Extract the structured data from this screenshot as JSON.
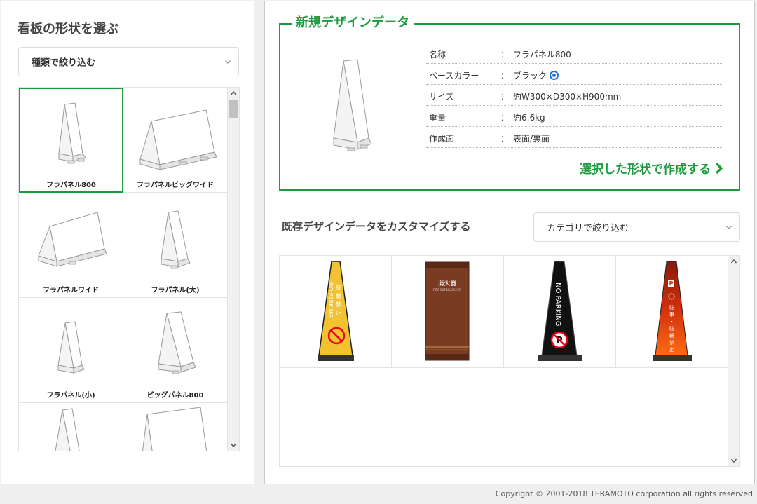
{
  "left_panel": {
    "title": "看板の形状を選ぶ",
    "filter": {
      "selected": "種類で絞り込む"
    },
    "shapes": [
      {
        "label": "フラパネル800",
        "selected": true
      },
      {
        "label": "フラパネルビッグワイド",
        "selected": false
      },
      {
        "label": "フラパネルワイド",
        "selected": false
      },
      {
        "label": "フラパネル(大)",
        "selected": false
      },
      {
        "label": "フラパネル(小)",
        "selected": false
      },
      {
        "label": "ビッグパネル800",
        "selected": false
      },
      {
        "label": "",
        "selected": false
      },
      {
        "label": "",
        "selected": false
      }
    ]
  },
  "new_design": {
    "title": "新規デザインデータ",
    "specs": [
      {
        "key": "名称",
        "value": "フラパネル800"
      },
      {
        "key": "ベースカラー",
        "value": "ブラック",
        "radio": true
      },
      {
        "key": "サイズ",
        "value": "約W300×D300×H900mm"
      },
      {
        "key": "重量",
        "value": "約6.6kg"
      },
      {
        "key": "作成面",
        "value": "表面/裏面"
      }
    ],
    "separator": "：",
    "create_label": "選択した形状で作成する"
  },
  "existing": {
    "title": "既存デザインデータをカスタマイズする",
    "filter": {
      "selected": "カテゴリで絞り込む"
    },
    "designs": [
      {
        "name": "yellow-cone",
        "vertical_text": "駐輪禁止",
        "side_text": "NO PARKING",
        "color": "#f2c230"
      },
      {
        "name": "wood-panel",
        "title": "消火器",
        "subtitle": "FIRE EXTINGUISHER",
        "color": "#7a3b22"
      },
      {
        "name": "black-cone",
        "text": "NO PARKING",
        "color": "#111111"
      },
      {
        "name": "orange-cone",
        "badge": "P",
        "vertical_text": "駐車・駐輪禁止",
        "color": "#ef5a14"
      }
    ]
  },
  "footer": {
    "copyright": "Copyright © 2001-2018 TERAMOTO corporation all rights reserved"
  },
  "colors": {
    "accent": "#1e9a3f",
    "radio": "#1a73d9"
  }
}
